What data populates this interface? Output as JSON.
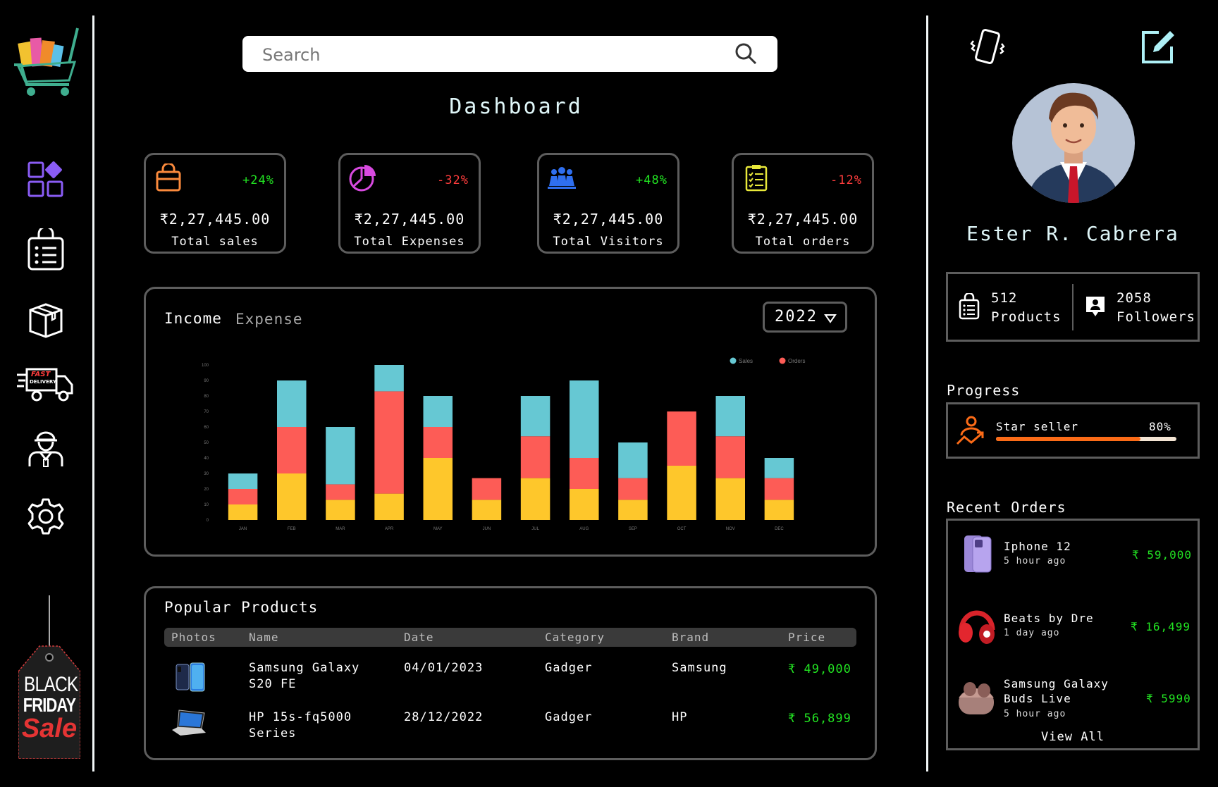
{
  "search": {
    "placeholder": "Search"
  },
  "page_title": "Dashboard",
  "colors": {
    "accent": "#dff6f8",
    "positive": "#22e322",
    "negative": "#ff3d3d",
    "sales": "#66c8d3",
    "expense": "#fd5c56",
    "orders": "#fec72b",
    "progress": "#fb6b17"
  },
  "sidebar": {
    "items": [
      {
        "icon": "grid-icon"
      },
      {
        "icon": "shopping-list-icon"
      },
      {
        "icon": "box-icon"
      },
      {
        "icon": "fast-delivery-icon"
      },
      {
        "icon": "delivery-man-icon"
      },
      {
        "icon": "settings-icon"
      }
    ],
    "promo": {
      "line1": "BLACK",
      "line2": "FRIDAY",
      "line3": "Sale"
    },
    "badge_fast": "FAST",
    "badge_delivery": "DELIVERY"
  },
  "stats": [
    {
      "icon": "shopping-bag-icon",
      "change": "+24%",
      "positive": true,
      "amount": "₹2,27,445.00",
      "label": "Total sales"
    },
    {
      "icon": "pie-chart-icon",
      "change": "-32%",
      "positive": false,
      "amount": "₹2,27,445.00",
      "label": "Total Expenses"
    },
    {
      "icon": "visitors-icon",
      "change": "+48%",
      "positive": true,
      "amount": "₹2,27,445.00",
      "label": "Total Visitors"
    },
    {
      "icon": "clipboard-icon",
      "change": "-12%",
      "positive": false,
      "amount": "₹2,27,445.00",
      "label": "Total orders"
    }
  ],
  "income_panel": {
    "tab_income": "Income",
    "tab_expense": "Expense",
    "year": "2022"
  },
  "chart_data": {
    "type": "bar",
    "stacked": true,
    "categories": [
      "JAN",
      "FEB",
      "MAR",
      "APR",
      "MAY",
      "JUN",
      "JUL",
      "AUG",
      "SEP",
      "OCT",
      "NOV",
      "DEC"
    ],
    "series": [
      {
        "name": "",
        "color": "#fec72b",
        "values": [
          10,
          30,
          13,
          17,
          40,
          13,
          27,
          20,
          13,
          35,
          27,
          13
        ]
      },
      {
        "name": "",
        "color": "#fd5c56",
        "values": [
          10,
          30,
          10,
          66,
          20,
          14,
          27,
          20,
          14,
          35,
          27,
          14
        ]
      },
      {
        "name": "Sales",
        "color": "#66c8d3",
        "values": [
          10,
          30,
          37,
          17,
          20,
          0,
          26,
          50,
          23,
          0,
          26,
          13
        ]
      }
    ],
    "legend": [
      {
        "name": "Sales",
        "color": "#66c8d3"
      },
      {
        "name": "Orders",
        "color": "#fd5c56"
      }
    ],
    "legend_position": "top-right",
    "ylim": [
      0,
      100
    ],
    "yticks": [
      0,
      10,
      20,
      30,
      40,
      50,
      60,
      70,
      80,
      90,
      100
    ],
    "grid": false
  },
  "popular_products": {
    "title": "Popular Products",
    "columns": [
      "Photos",
      "Name",
      "Date",
      "Category",
      "Brand",
      "Price"
    ],
    "rows": [
      {
        "photo": "phone-photo",
        "name_l1": "Samsung Galaxy",
        "name_l2": "S20 FE",
        "date": "04/01/2023",
        "category": "Gadger",
        "brand": "Samsung",
        "price": "₹ 49,000"
      },
      {
        "photo": "laptop-photo",
        "name_l1": "HP 15s-fq5000",
        "name_l2": "Series",
        "date": "28/12/2022",
        "category": "Gadger",
        "brand": "HP",
        "price": "₹ 56,899"
      }
    ]
  },
  "profile": {
    "name": "Ester R. Cabrera",
    "products_count": "512",
    "products_label": "Products",
    "followers_count": "2058",
    "followers_label": "Followers"
  },
  "progress": {
    "title": "Progress",
    "label": "Star seller",
    "percent_text": "80%",
    "value": 80
  },
  "recent_orders": {
    "title": "Recent Orders",
    "items": [
      {
        "name_l1": "Iphone 12",
        "name_l2": "",
        "time": "5 hour ago",
        "price": "₹ 59,000"
      },
      {
        "name_l1": "Beats by Dre",
        "name_l2": "",
        "time": "1 day ago",
        "price": "₹ 16,499"
      },
      {
        "name_l1": "Samsung Galaxy",
        "name_l2": "Buds Live",
        "time": "5 hour ago",
        "price": "₹ 5990"
      }
    ],
    "view_all": "View All"
  }
}
